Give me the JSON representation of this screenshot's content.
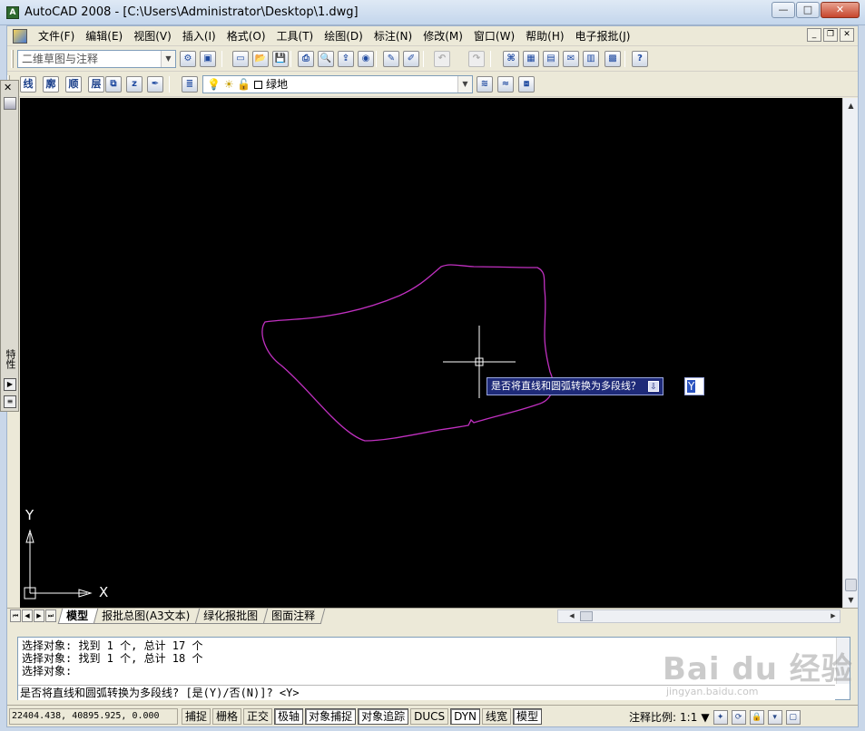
{
  "window": {
    "title": "AutoCAD 2008 - [C:\\Users\\Administrator\\Desktop\\1.dwg]",
    "minimize_glyph": "—",
    "maximize_glyph": "□",
    "close_glyph": "✕",
    "app_icon_text": "A"
  },
  "menubar": {
    "items": [
      "文件(F)",
      "编辑(E)",
      "视图(V)",
      "插入(I)",
      "格式(O)",
      "工具(T)",
      "绘图(D)",
      "标注(N)",
      "修改(M)",
      "窗口(W)",
      "帮助(H)",
      "电子报批(J)"
    ],
    "mdi_min": "_",
    "mdi_restore": "❐",
    "mdi_close": "✕"
  },
  "toolbar1": {
    "workspace_combo": "二维草图与注释",
    "combo_arrow": "▼",
    "tools": [
      {
        "icon": "workspace-settings-icon",
        "glyph": "⚙"
      },
      {
        "icon": "my-workspace-icon",
        "glyph": "▣"
      },
      {
        "icon": "new-icon",
        "glyph": "▭"
      },
      {
        "icon": "open-icon",
        "glyph": "📂"
      },
      {
        "icon": "save-icon",
        "glyph": "💾"
      },
      {
        "icon": "print-icon",
        "glyph": "⎙"
      },
      {
        "icon": "plot-preview-icon",
        "glyph": "🔍"
      },
      {
        "icon": "publish-icon",
        "glyph": "⇪"
      },
      {
        "icon": "3d-dwf-icon",
        "glyph": "◉"
      },
      {
        "icon": "match-properties-icon",
        "glyph": "✎"
      },
      {
        "icon": "block-editor-icon",
        "glyph": "✐"
      },
      {
        "icon": "undo-icon",
        "glyph": "↶"
      },
      {
        "icon": "redo-icon",
        "glyph": "↷"
      },
      {
        "icon": "design-center-icon",
        "glyph": "⌘"
      },
      {
        "icon": "tool-palettes-icon",
        "glyph": "▦"
      },
      {
        "icon": "sheet-set-icon",
        "glyph": "▤"
      },
      {
        "icon": "markup-icon",
        "glyph": "✉"
      },
      {
        "icon": "dbconnect-icon",
        "glyph": "▥"
      },
      {
        "icon": "quickcalc-icon",
        "glyph": "▩"
      },
      {
        "icon": "help-icon",
        "glyph": "?"
      }
    ]
  },
  "toolbar2": {
    "custom_buttons": [
      "线",
      "廓",
      "顺",
      "层"
    ],
    "extra_tools": [
      {
        "icon": "layer-state-icon",
        "glyph": "⧉"
      },
      {
        "icon": "z-down-icon",
        "glyph": "z"
      },
      {
        "icon": "pen-icon",
        "glyph": "✒"
      }
    ],
    "layer_combo": "绿地",
    "layer_tools": [
      {
        "icon": "make-current-layer-icon",
        "glyph": "≋"
      },
      {
        "icon": "layer-previous-icon",
        "glyph": "≈"
      },
      {
        "icon": "layer-isolate-icon",
        "glyph": "⧈"
      }
    ],
    "layer_manager_glyph": "≣"
  },
  "palette": {
    "close_glyph": "✕",
    "label": "特性",
    "auto_hide_glyph": "▶",
    "menu_glyph": "≡"
  },
  "drawing": {
    "dyn_prompt": "是否将直线和圆弧转换为多段线？",
    "dyn_prompt_icon": "⇩",
    "dyn_input": "Y",
    "ucs_x": "X",
    "ucs_y": "Y",
    "polyline_color": "#c030c0",
    "background": "#000000",
    "scroll_up": "▲",
    "scroll_down": "▼"
  },
  "tabs": {
    "nav": [
      "⏮",
      "◀",
      "▶",
      "⏭"
    ],
    "items": [
      "模型",
      "报批总图(A3文本)",
      "绿化报批图",
      "图面注释"
    ],
    "active": "模型",
    "hscroll_left": "◀",
    "hscroll_right": "▶"
  },
  "command": {
    "history": [
      "选择对象: 找到 1 个, 总计 17 个",
      "选择对象: 找到 1 个, 总计 18 个",
      "选择对象:"
    ],
    "current": "是否将直线和圆弧转换为多段线? [是(Y)/否(N)]? <Y>"
  },
  "status": {
    "coords": "22404.438, 40895.925, 0.000",
    "buttons": [
      {
        "label": "捕捉",
        "on": false
      },
      {
        "label": "栅格",
        "on": false
      },
      {
        "label": "正交",
        "on": false
      },
      {
        "label": "极轴",
        "on": true
      },
      {
        "label": "对象捕捉",
        "on": true
      },
      {
        "label": "对象追踪",
        "on": true
      },
      {
        "label": "DUCS",
        "on": false
      },
      {
        "label": "DYN",
        "on": true
      },
      {
        "label": "线宽",
        "on": false
      },
      {
        "label": "模型",
        "on": true
      }
    ],
    "annotation_scale_label": "注释比例:",
    "annotation_scale": "1:1",
    "annotation_scale_arrow": "▼",
    "tray_icons": [
      {
        "icon": "annotation-visibility-icon",
        "glyph": "✦"
      },
      {
        "icon": "auto-scale-icon",
        "glyph": "⟳"
      },
      {
        "icon": "lock-icon",
        "glyph": "🔒"
      },
      {
        "icon": "status-tray-settings-icon",
        "glyph": "▾"
      },
      {
        "icon": "clean-screen-icon",
        "glyph": "▢"
      }
    ]
  },
  "watermark": {
    "brand": "Bai du 经验",
    "url": "jingyan.baidu.com"
  }
}
